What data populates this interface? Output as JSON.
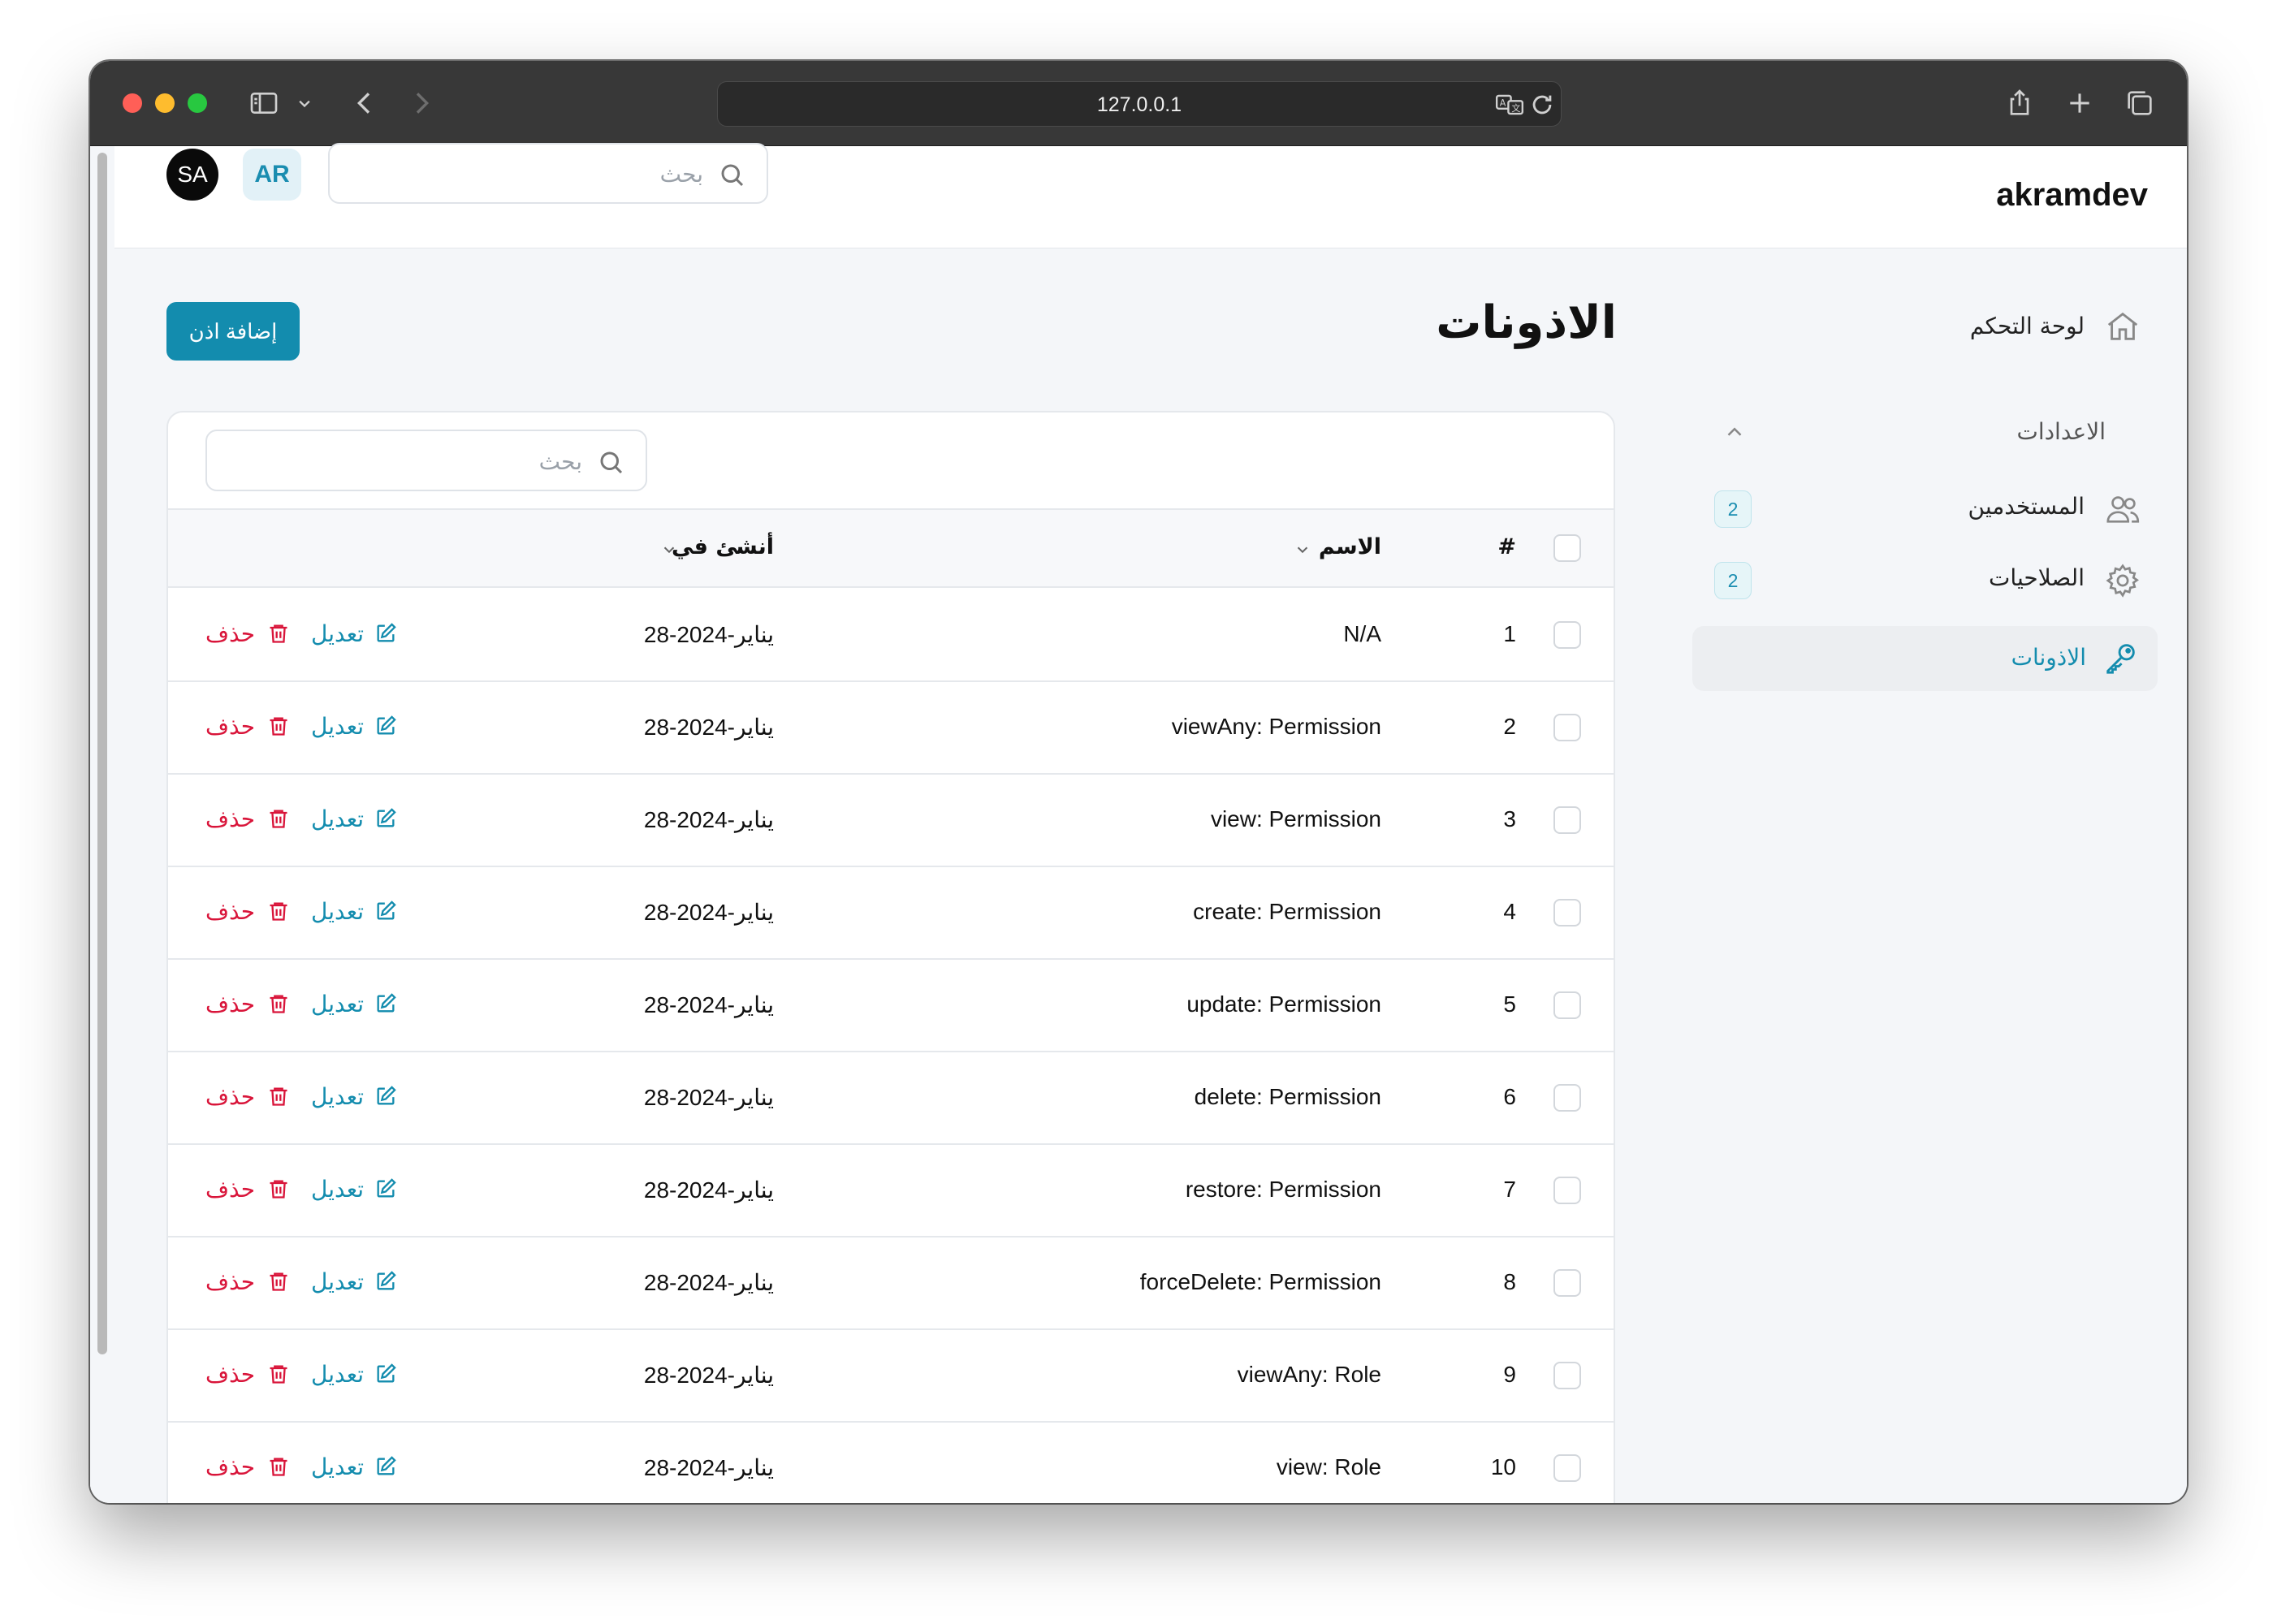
{
  "browser": {
    "url": "127.0.0.1"
  },
  "header": {
    "brand": "akramdev",
    "search_placeholder": "بحث",
    "language": "AR",
    "avatar_initials": "SA"
  },
  "sidebar": {
    "dashboard_label": "لوحة التحكم",
    "settings_group_label": "الاعدادات",
    "items": [
      {
        "label": "المستخدمين",
        "count": "2",
        "icon": "users-icon"
      },
      {
        "label": "الصلاحيات",
        "count": "2",
        "icon": "gear-icon"
      },
      {
        "label": "الاذونات",
        "icon": "key-icon",
        "active": true
      }
    ]
  },
  "main": {
    "title": "الاذونات",
    "add_button": "إضافة اذن",
    "table_search_placeholder": "بحث",
    "columns": {
      "number": "#",
      "name": "الاسم",
      "created_at": "أنشئ في"
    },
    "edit_label": "تعديل",
    "delete_label": "حذف",
    "rows": [
      {
        "num": "1",
        "name": "N/A",
        "date": "28-يناير-2024"
      },
      {
        "num": "2",
        "name": "viewAny: Permission",
        "date": "28-يناير-2024"
      },
      {
        "num": "3",
        "name": "view: Permission",
        "date": "28-يناير-2024"
      },
      {
        "num": "4",
        "name": "create: Permission",
        "date": "28-يناير-2024"
      },
      {
        "num": "5",
        "name": "update: Permission",
        "date": "28-يناير-2024"
      },
      {
        "num": "6",
        "name": "delete: Permission",
        "date": "28-يناير-2024"
      },
      {
        "num": "7",
        "name": "restore: Permission",
        "date": "28-يناير-2024"
      },
      {
        "num": "8",
        "name": "forceDelete: Permission",
        "date": "28-يناير-2024"
      },
      {
        "num": "9",
        "name": "viewAny: Role",
        "date": "28-يناير-2024"
      },
      {
        "num": "10",
        "name": "view: Role",
        "date": "28-يناير-2024"
      }
    ]
  },
  "colors": {
    "accent": "#138cae",
    "danger": "#d9153a",
    "chrome": "#383838"
  }
}
